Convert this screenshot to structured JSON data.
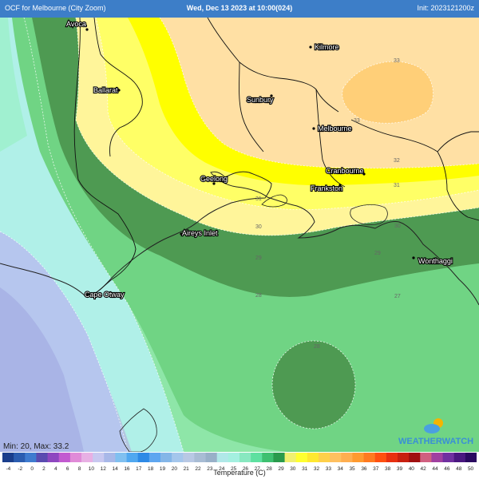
{
  "header": {
    "left": "OCF  for Melbourne (City Zoom)",
    "center": "Wed, Dec 13 2023 at 10:00(024)",
    "right": "Init: 2023121200z"
  },
  "towns": [
    {
      "name": "Avoca"
    },
    {
      "name": "Kilmore"
    },
    {
      "name": "Ballarat"
    },
    {
      "name": "Sunbury"
    },
    {
      "name": "Melbourne"
    },
    {
      "name": "Cranbourne"
    },
    {
      "name": "Geelong"
    },
    {
      "name": "Frankston"
    },
    {
      "name": "Aireys Inlet"
    },
    {
      "name": "Wonthaggi"
    },
    {
      "name": "Cape Otway"
    }
  ],
  "contour_labels": [
    {
      "value": "33"
    },
    {
      "value": "33"
    },
    {
      "value": "32"
    },
    {
      "value": "31"
    },
    {
      "value": "31"
    },
    {
      "value": "30"
    },
    {
      "value": "30"
    },
    {
      "value": "29"
    },
    {
      "value": "29"
    },
    {
      "value": "28"
    },
    {
      "value": "27"
    },
    {
      "value": "28"
    }
  ],
  "colorbar": {
    "colors": [
      "#1a3e8c",
      "#2b5db0",
      "#3f7bcf",
      "#5a4bb0",
      "#8e47c0",
      "#c25ad0",
      "#e08bd8",
      "#e8b0e4",
      "#c8c8f0",
      "#a8b8e8",
      "#80c0f0",
      "#50a8f0",
      "#2e8ae6",
      "#5ea6f0",
      "#84b6e8",
      "#a4c6ec",
      "#b8c8e4",
      "#a8bcd4",
      "#98b0c8",
      "#b0e8e8",
      "#a4f0e0",
      "#88e8c0",
      "#5ee0a0",
      "#3ec070",
      "#2a9a4c",
      "#f0f070",
      "#ffff30",
      "#ffe830",
      "#ffd04a",
      "#ffc060",
      "#ffae50",
      "#ff9a30",
      "#ff7a20",
      "#ff5010",
      "#e83010",
      "#c82010",
      "#a01010",
      "#d06080",
      "#a040a0",
      "#7030a0",
      "#4a1880",
      "#2a0a60"
    ],
    "tick_labels": [
      "-4",
      "-2",
      "0",
      "2",
      "4",
      "6",
      "8",
      "10",
      "12",
      "14",
      "16",
      "17",
      "18",
      "19",
      "20",
      "21",
      "22",
      "23",
      "24",
      "25",
      "26",
      "27",
      "28",
      "29",
      "30",
      "31",
      "32",
      "33",
      "34",
      "35",
      "36",
      "37",
      "38",
      "39",
      "40",
      "42",
      "44",
      "46",
      "48",
      "50"
    ],
    "unit_label": "Temperature (C)"
  },
  "stats": {
    "text": "Min: 20, Max: 33.2"
  },
  "logo": {
    "text": "WEATHERWATCH"
  }
}
